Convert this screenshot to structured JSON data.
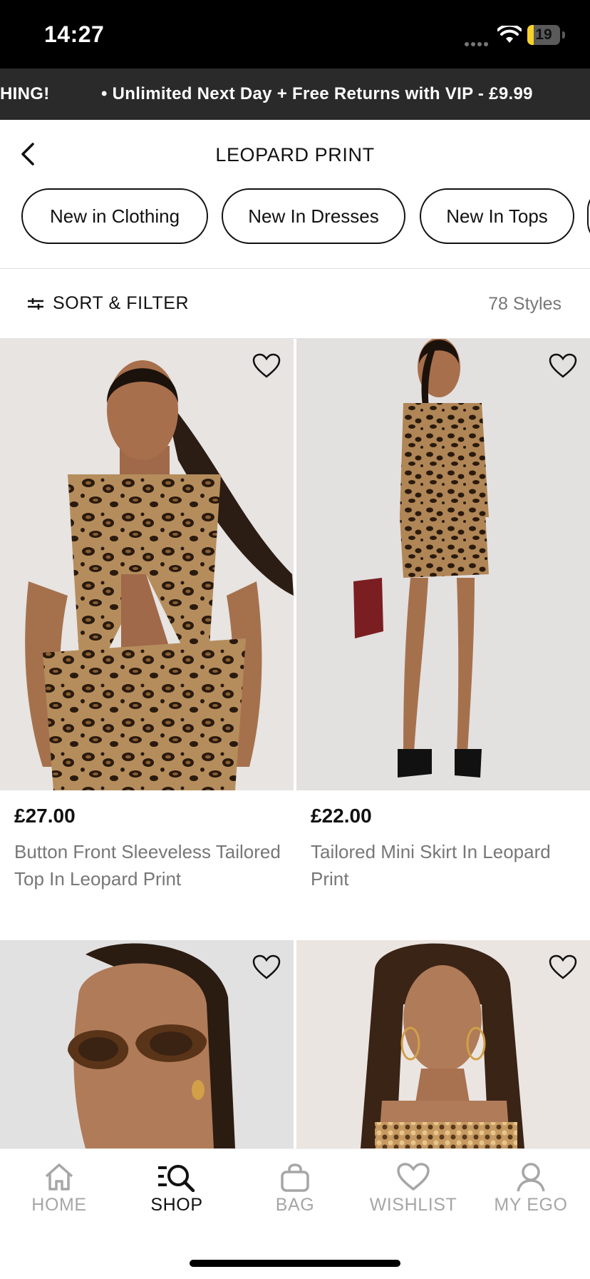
{
  "status_bar": {
    "time": "14:27",
    "battery": "19"
  },
  "promo": {
    "left_text": "HING!",
    "main_text": "• Unlimited Next Day + Free Returns with VIP - £9.99"
  },
  "header": {
    "title": "LEOPARD PRINT"
  },
  "chips": [
    "New in Clothing",
    "New In Dresses",
    "New In Tops"
  ],
  "filter": {
    "label": "SORT & FILTER",
    "count": "78 Styles"
  },
  "products": [
    {
      "price": "£27.00",
      "name": "Button Front Sleeveless Tailored Top In Leopard Print"
    },
    {
      "price": "£22.00",
      "name": "Tailored Mini Skirt In Leopard Print"
    }
  ],
  "tabs": [
    {
      "label": "HOME",
      "icon": "home-icon"
    },
    {
      "label": "SHOP",
      "icon": "shop-search-icon"
    },
    {
      "label": "BAG",
      "icon": "bag-icon"
    },
    {
      "label": "WISHLIST",
      "icon": "heart-icon"
    },
    {
      "label": "MY EGO",
      "icon": "person-icon"
    }
  ],
  "active_tab": "SHOP",
  "colors": {
    "promo_bg": "#2a2a2a",
    "status_bg": "#000000",
    "inactive_tab": "#a6a6a6",
    "battery": "#f6d22b"
  }
}
